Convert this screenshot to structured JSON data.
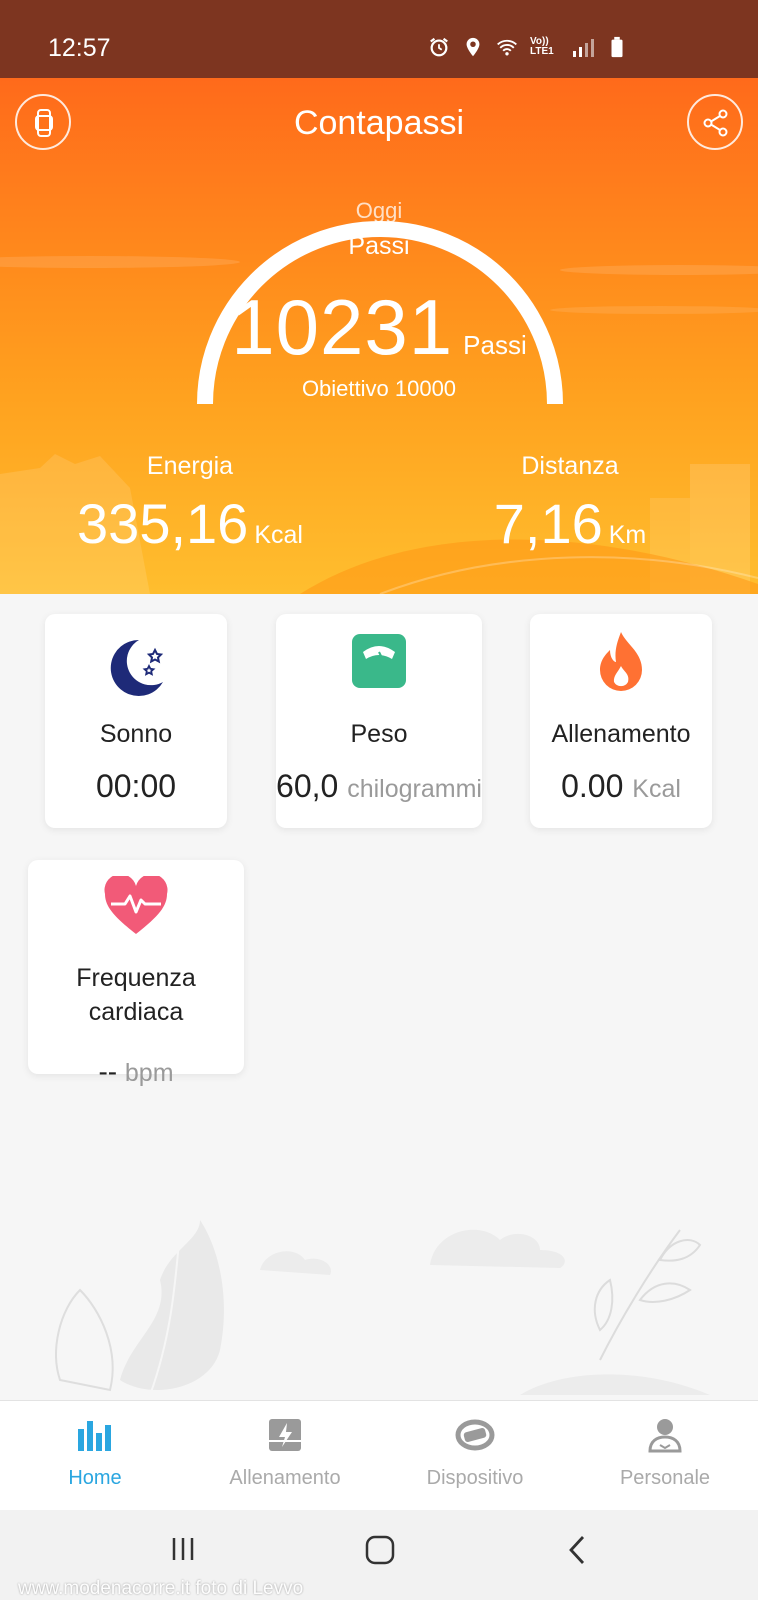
{
  "status_bar": {
    "time": "12:57",
    "network_label": "Vo)) LTE1",
    "icons": [
      "alarm-icon",
      "location-icon",
      "wifi-icon",
      "signal-icon",
      "battery-icon"
    ]
  },
  "header": {
    "title": "Contapassi",
    "left_icon": "watch-icon",
    "right_icon": "share-icon"
  },
  "steps": {
    "period": "Oggi",
    "label": "Passi",
    "value": "10231",
    "unit": "Passi",
    "goal_text": "Obiettivo 10000",
    "progress": 1.0
  },
  "energy": {
    "label": "Energia",
    "value": "335,16",
    "unit": "Kcal"
  },
  "distance": {
    "label": "Distanza",
    "value": "7,16",
    "unit": "Km"
  },
  "cards": {
    "sleep": {
      "title": "Sonno",
      "value": "00:00",
      "unit": "",
      "icon": "moon-icon"
    },
    "weight": {
      "title": "Peso",
      "value": "60,0",
      "unit": "chilogrammi",
      "icon": "scale-icon"
    },
    "training": {
      "title": "Allenamento",
      "value": "0.00",
      "unit": "Kcal",
      "icon": "flame-icon"
    },
    "heart": {
      "title_line1": "Frequenza",
      "title_line2": "cardiaca",
      "value": "--",
      "unit": "bpm",
      "icon": "heart-icon"
    }
  },
  "bottom_nav": [
    {
      "label": "Home",
      "icon": "bar-chart-icon",
      "active": true
    },
    {
      "label": "Allenamento",
      "icon": "workout-icon",
      "active": false
    },
    {
      "label": "Dispositivo",
      "icon": "band-icon",
      "active": false
    },
    {
      "label": "Personale",
      "icon": "person-icon",
      "active": false
    }
  ],
  "watermark": "www.modenacorre.it foto di Levvo",
  "colors": {
    "status_bar": "#7d3520",
    "hero_top": "#ff6a1b",
    "hero_bottom": "#ffbe2e",
    "active_tab": "#2aa6e0",
    "moon": "#1e2a78",
    "scale": "#3ab88a",
    "flame": "#ff7133",
    "heart": "#f25a78"
  }
}
